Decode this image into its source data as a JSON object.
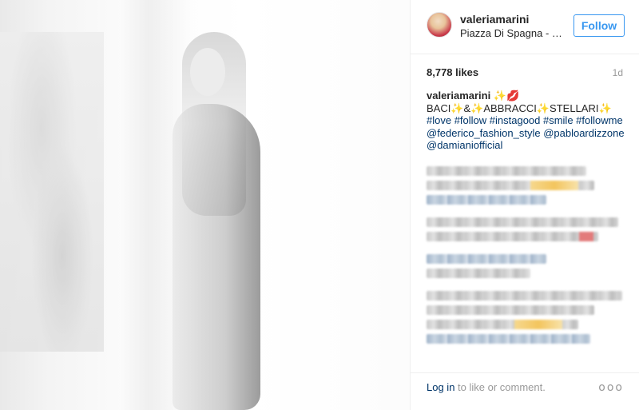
{
  "post": {
    "username": "valeriamarini",
    "location": "Piazza Di Spagna - R...",
    "follow_label": "Follow",
    "likes": "8,778 likes",
    "time": "1d"
  },
  "caption": {
    "username": "valeriamarini",
    "line1_emoji": "✨💋",
    "line2": "BACI✨&✨ABBRACCI✨STELLARI✨",
    "hashtags": "#love #follow #instagood #smile #followme",
    "mention1": "@federico_fashion_style",
    "mention2": "@pabloardizzone",
    "mention3": "@damianiofficial"
  },
  "footer": {
    "login_link": "Log in",
    "login_rest": " to like or comment.",
    "more_icon": "ellipsis-icon",
    "more_glyph": "ooo"
  },
  "colors": {
    "link_blue": "#003569",
    "follow_blue": "#3897f0",
    "muted_gray": "#999999"
  }
}
